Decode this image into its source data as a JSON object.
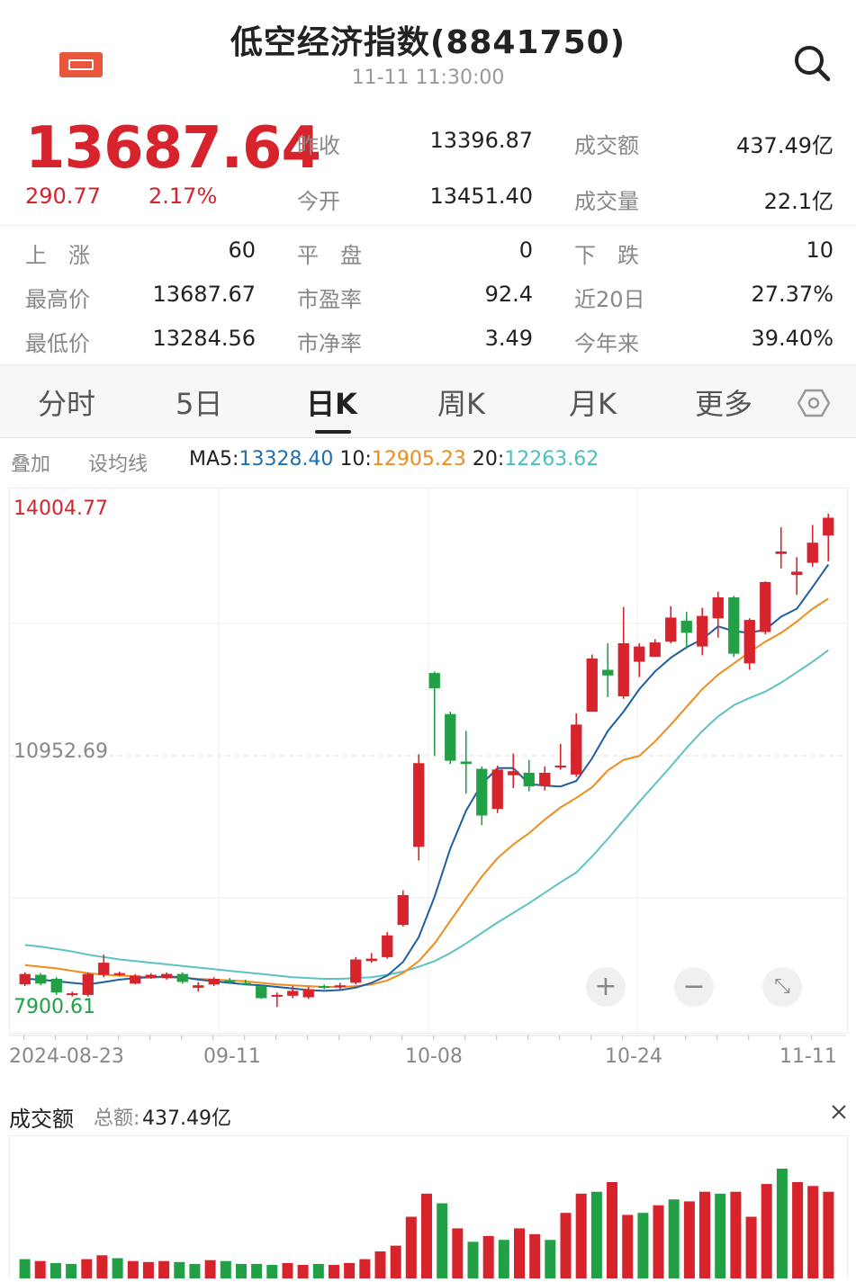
{
  "header": {
    "title": "低空经济指数(8841750)",
    "time": "11-11 11:30:00",
    "logo_icon": "app-logo-icon",
    "search_icon": "search-icon"
  },
  "quote": {
    "price": "13687.64",
    "change": "290.77",
    "change_pct": "2.17%",
    "price_color": "#d6232c",
    "stats_row1": [
      {
        "label": "昨收",
        "value": "13396.87"
      },
      {
        "label": "成交额",
        "value": "437.49亿"
      }
    ],
    "stats_row2": [
      {
        "label": "今开",
        "value": "13451.40"
      },
      {
        "label": "成交量",
        "value": "22.1亿"
      }
    ],
    "grid": [
      [
        {
          "label": "上　涨",
          "value": "60"
        },
        {
          "label": "平　盘",
          "value": "0"
        },
        {
          "label": "下　跌",
          "value": "10"
        }
      ],
      [
        {
          "label": "最高价",
          "value": "13687.67"
        },
        {
          "label": "市盈率",
          "value": "92.4"
        },
        {
          "label": "近20日",
          "value": "27.37%"
        }
      ],
      [
        {
          "label": "最低价",
          "value": "13284.56"
        },
        {
          "label": "市净率",
          "value": "3.49"
        },
        {
          "label": "今年来",
          "value": "39.40%"
        }
      ]
    ]
  },
  "tabs": {
    "items": [
      "分时",
      "5日",
      "日K",
      "周K",
      "月K",
      "更多"
    ],
    "active": "日K",
    "settings_icon": "settings-hex-icon"
  },
  "ma": {
    "overlay": "叠加",
    "set_ma": "设均线",
    "ma5_label": "MA5:",
    "ma5_value": "13328.40",
    "ma10_label": "10:",
    "ma10_value": "12905.23",
    "ma20_label": "20:",
    "ma20_value": "12263.62",
    "colors": {
      "ma5": "#1f5f9e",
      "ma10": "#f08c1c",
      "ma20": "#5cc2c2"
    }
  },
  "chart_data": {
    "type": "candlestick",
    "y_max_label": "14004.77",
    "y_mid_label": "10952.69",
    "y_min_label": "7900.61",
    "ylim": [
      7900.61,
      14004.77
    ],
    "x_labels": [
      "2024-08-23",
      "09-11",
      "10-08",
      "10-24",
      "11-11"
    ],
    "up_color": "#d6232c",
    "down_color": "#21a046",
    "candles": [
      {
        "o": 8110,
        "c": 8240,
        "h": 8260,
        "l": 8090
      },
      {
        "o": 8230,
        "c": 8120,
        "h": 8250,
        "l": 8100
      },
      {
        "o": 8180,
        "c": 8010,
        "h": 8200,
        "l": 7980
      },
      {
        "o": 7980,
        "c": 8000,
        "h": 8020,
        "l": 7960
      },
      {
        "o": 7980,
        "c": 8240,
        "h": 8260,
        "l": 7960
      },
      {
        "o": 8230,
        "c": 8380,
        "h": 8480,
        "l": 8200
      },
      {
        "o": 8230,
        "c": 8250,
        "h": 8270,
        "l": 8210
      },
      {
        "o": 8120,
        "c": 8220,
        "h": 8240,
        "l": 8110
      },
      {
        "o": 8190,
        "c": 8230,
        "h": 8250,
        "l": 8180
      },
      {
        "o": 8190,
        "c": 8240,
        "h": 8260,
        "l": 8170
      },
      {
        "o": 8240,
        "c": 8140,
        "h": 8260,
        "l": 8120
      },
      {
        "o": 8070,
        "c": 8100,
        "h": 8140,
        "l": 8020
      },
      {
        "o": 8110,
        "c": 8180,
        "h": 8200,
        "l": 8090
      },
      {
        "o": 8160,
        "c": 8150,
        "h": 8190,
        "l": 8120
      },
      {
        "o": 8130,
        "c": 8120,
        "h": 8170,
        "l": 8100
      },
      {
        "o": 8090,
        "c": 7940,
        "h": 8100,
        "l": 7930
      },
      {
        "o": 7970,
        "c": 7980,
        "h": 8010,
        "l": 7830
      },
      {
        "o": 7970,
        "c": 8030,
        "h": 8090,
        "l": 7940
      },
      {
        "o": 7950,
        "c": 8050,
        "h": 8080,
        "l": 7930
      },
      {
        "o": 8090,
        "c": 8080,
        "h": 8110,
        "l": 8050
      },
      {
        "o": 8090,
        "c": 8100,
        "h": 8130,
        "l": 8040
      },
      {
        "o": 8130,
        "c": 8420,
        "h": 8450,
        "l": 8110
      },
      {
        "o": 8400,
        "c": 8430,
        "h": 8500,
        "l": 8380
      },
      {
        "o": 8450,
        "c": 8720,
        "h": 8760,
        "l": 8430
      },
      {
        "o": 8850,
        "c": 9220,
        "h": 9280,
        "l": 8830
      },
      {
        "o": 9820,
        "c": 10860,
        "h": 10970,
        "l": 9650
      },
      {
        "o": 11980,
        "c": 11790,
        "h": 12000,
        "l": 10950
      },
      {
        "o": 11470,
        "c": 10890,
        "h": 11500,
        "l": 10850
      },
      {
        "o": 10880,
        "c": 10850,
        "h": 11260,
        "l": 10480
      },
      {
        "o": 10790,
        "c": 10210,
        "h": 10820,
        "l": 10090
      },
      {
        "o": 10290,
        "c": 10780,
        "h": 10830,
        "l": 10240
      },
      {
        "o": 10710,
        "c": 10760,
        "h": 10980,
        "l": 10550
      },
      {
        "o": 10740,
        "c": 10570,
        "h": 10900,
        "l": 10510
      },
      {
        "o": 10580,
        "c": 10740,
        "h": 10820,
        "l": 10520
      },
      {
        "o": 10810,
        "c": 10830,
        "h": 11100,
        "l": 10780
      },
      {
        "o": 10720,
        "c": 11340,
        "h": 11480,
        "l": 10690
      },
      {
        "o": 11500,
        "c": 12160,
        "h": 12210,
        "l": 11500
      },
      {
        "o": 12020,
        "c": 11950,
        "h": 12350,
        "l": 11680
      },
      {
        "o": 11690,
        "c": 12350,
        "h": 12800,
        "l": 11660
      },
      {
        "o": 12120,
        "c": 12310,
        "h": 12350,
        "l": 11930
      },
      {
        "o": 12180,
        "c": 12360,
        "h": 12400,
        "l": 12180
      },
      {
        "o": 12370,
        "c": 12670,
        "h": 12810,
        "l": 12350
      },
      {
        "o": 12630,
        "c": 12480,
        "h": 12740,
        "l": 12280
      },
      {
        "o": 12310,
        "c": 12690,
        "h": 12790,
        "l": 12200
      },
      {
        "o": 12660,
        "c": 12920,
        "h": 12990,
        "l": 12420
      },
      {
        "o": 12920,
        "c": 12220,
        "h": 12940,
        "l": 12180
      },
      {
        "o": 12100,
        "c": 12640,
        "h": 12660,
        "l": 12020
      },
      {
        "o": 12490,
        "c": 13110,
        "h": 13120,
        "l": 12460
      },
      {
        "o": 13460,
        "c": 13490,
        "h": 13790,
        "l": 13280
      },
      {
        "o": 13200,
        "c": 13240,
        "h": 13420,
        "l": 12950
      },
      {
        "o": 13350,
        "c": 13600,
        "h": 13820,
        "l": 13300
      },
      {
        "o": 13690,
        "c": 13910,
        "h": 13960,
        "l": 13370
      }
    ],
    "ma5": [
      8180,
      8170,
      8150,
      8130,
      8110,
      8140,
      8170,
      8190,
      8200,
      8210,
      8200,
      8170,
      8150,
      8130,
      8110,
      8100,
      8080,
      8060,
      8040,
      8030,
      8040,
      8070,
      8130,
      8220,
      8390,
      8700,
      9200,
      9800,
      10270,
      10600,
      10800,
      10800,
      10600,
      10580,
      10570,
      10640,
      10920,
      11260,
      11500,
      11780,
      12000,
      12170,
      12300,
      12400,
      12560,
      12500,
      12480,
      12520,
      12680,
      12780,
      13050,
      13328
    ],
    "ma10": [
      8350,
      8330,
      8310,
      8280,
      8250,
      8230,
      8220,
      8210,
      8200,
      8200,
      8190,
      8180,
      8170,
      8160,
      8150,
      8130,
      8110,
      8100,
      8090,
      8080,
      8080,
      8090,
      8110,
      8160,
      8250,
      8400,
      8620,
      8900,
      9180,
      9450,
      9680,
      9850,
      9990,
      10160,
      10310,
      10430,
      10560,
      10770,
      10900,
      10950,
      11130,
      11340,
      11560,
      11780,
      11960,
      12100,
      12240,
      12370,
      12480,
      12620,
      12780,
      12905
    ],
    "ma20": [
      8600,
      8580,
      8550,
      8520,
      8480,
      8450,
      8420,
      8400,
      8380,
      8360,
      8340,
      8320,
      8300,
      8280,
      8260,
      8240,
      8220,
      8200,
      8190,
      8180,
      8180,
      8190,
      8200,
      8230,
      8270,
      8330,
      8400,
      8500,
      8620,
      8750,
      8880,
      9000,
      9120,
      9250,
      9380,
      9500,
      9700,
      9920,
      10150,
      10380,
      10600,
      10820,
      11050,
      11260,
      11440,
      11580,
      11670,
      11750,
      11860,
      11990,
      12120,
      12264
    ]
  },
  "volume": {
    "title": "成交额",
    "total_label": "总额:",
    "total_value": "437.49亿",
    "close_icon": "close-icon",
    "values": [
      20,
      18,
      16,
      15,
      20,
      24,
      21,
      18,
      17,
      18,
      17,
      15,
      19,
      18,
      15,
      15,
      14,
      16,
      14,
      15,
      14,
      16,
      20,
      28,
      34,
      64,
      88,
      78,
      52,
      38,
      44,
      40,
      52,
      46,
      40,
      68,
      88,
      90,
      100,
      66,
      68,
      76,
      82,
      80,
      90,
      88,
      90,
      64,
      98,
      114,
      100,
      96,
      90
    ],
    "directions": [
      "d",
      "u",
      "d",
      "d",
      "u",
      "u",
      "d",
      "u",
      "u",
      "u",
      "d",
      "d",
      "u",
      "d",
      "d",
      "d",
      "d",
      "u",
      "u",
      "d",
      "u",
      "u",
      "u",
      "u",
      "u",
      "u",
      "u",
      "d",
      "u",
      "d",
      "u",
      "d",
      "u",
      "u",
      "d",
      "u",
      "u",
      "d",
      "u",
      "u",
      "d",
      "u",
      "d",
      "u",
      "u",
      "d",
      "u",
      "u",
      "u",
      "d",
      "u",
      "u",
      "u"
    ]
  }
}
